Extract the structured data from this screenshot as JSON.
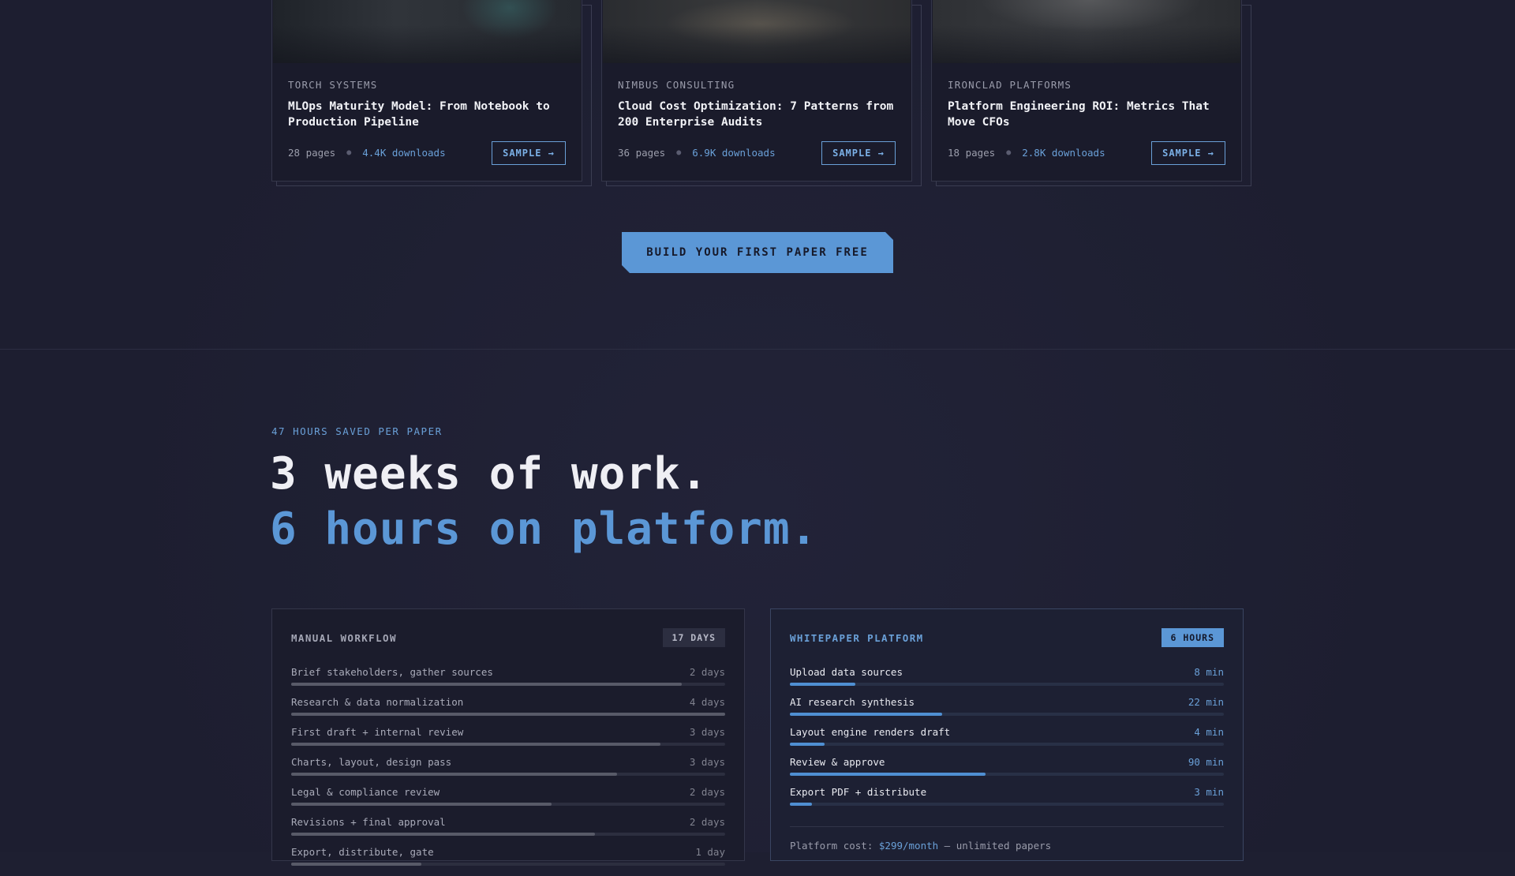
{
  "cards": [
    {
      "company": "TORCH SYSTEMS",
      "title": "MLOps Maturity Model: From Notebook to Production Pipeline",
      "pages": "28 pages",
      "downloads": "4.4K downloads",
      "button": "SAMPLE →"
    },
    {
      "company": "NIMBUS CONSULTING",
      "title": "Cloud Cost Optimization: 7 Patterns from 200 Enterprise Audits",
      "pages": "36 pages",
      "downloads": "6.9K downloads",
      "button": "SAMPLE →"
    },
    {
      "company": "IRONCLAD PLATFORMS",
      "title": "Platform Engineering ROI: Metrics That Move CFOs",
      "pages": "18 pages",
      "downloads": "2.8K downloads",
      "button": "SAMPLE →"
    }
  ],
  "cta": {
    "label": "BUILD YOUR FIRST PAPER FREE"
  },
  "headline": {
    "eyebrow": "47 HOURS SAVED PER PAPER",
    "line1": "3 weeks of work.",
    "line2": "6 hours on platform."
  },
  "manual": {
    "title": "MANUAL WORKFLOW",
    "badge": "17 DAYS",
    "rows": [
      {
        "label": "Brief stakeholders, gather sources",
        "value": "2 days",
        "progress": 0.9
      },
      {
        "label": "Research & data normalization",
        "value": "4 days",
        "progress": 1.0
      },
      {
        "label": "First draft + internal review",
        "value": "3 days",
        "progress": 0.85
      },
      {
        "label": "Charts, layout, design pass",
        "value": "3 days",
        "progress": 0.75
      },
      {
        "label": "Legal & compliance review",
        "value": "2 days",
        "progress": 0.6
      },
      {
        "label": "Revisions + final approval",
        "value": "2 days",
        "progress": 0.7
      },
      {
        "label": "Export, distribute, gate",
        "value": "1 day",
        "progress": 0.3
      }
    ]
  },
  "platform": {
    "title": "WHITEPAPER PLATFORM",
    "badge": "6 HOURS",
    "rows": [
      {
        "label": "Upload data sources",
        "value": "8 min",
        "progress": 0.15
      },
      {
        "label": "AI research synthesis",
        "value": "22 min",
        "progress": 0.35
      },
      {
        "label": "Layout engine renders draft",
        "value": "4 min",
        "progress": 0.08
      },
      {
        "label": "Review & approve",
        "value": "90 min",
        "progress": 0.45
      },
      {
        "label": "Export PDF + distribute",
        "value": "3 min",
        "progress": 0.05
      }
    ],
    "cost_prefix": "Platform cost: ",
    "cost_price": "$299/month",
    "cost_suffix": " — unlimited papers"
  },
  "colors": {
    "background": "#1e1f31",
    "accent": "#5b97d6",
    "card": "#1a1b2b"
  }
}
